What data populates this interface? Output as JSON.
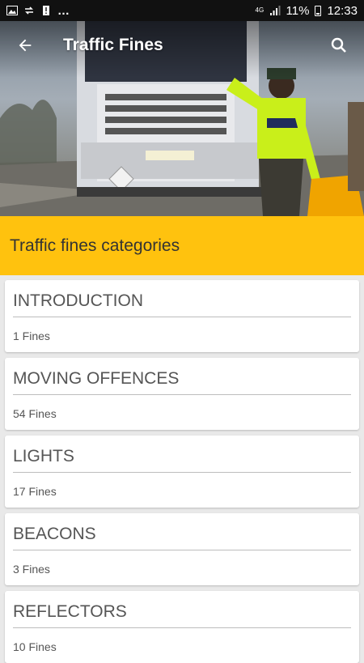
{
  "status_bar": {
    "network": "4G",
    "battery": "11%",
    "time": "12:33"
  },
  "app_bar": {
    "title": "Traffic Fines",
    "back_icon": "arrow-back-icon",
    "search_icon": "search-icon"
  },
  "colors": {
    "banner": "#ffc20e",
    "card": "#ffffff",
    "background": "#e9e9e9"
  },
  "banner": {
    "label": "Traffic fines categories"
  },
  "categories": [
    {
      "title": "INTRODUCTION",
      "count": "1 Fines"
    },
    {
      "title": "MOVING OFFENCES",
      "count": "54 Fines"
    },
    {
      "title": "LIGHTS",
      "count": "17 Fines"
    },
    {
      "title": "BEACONS",
      "count": "3 Fines"
    },
    {
      "title": "REFLECTORS",
      "count": "10 Fines"
    }
  ]
}
